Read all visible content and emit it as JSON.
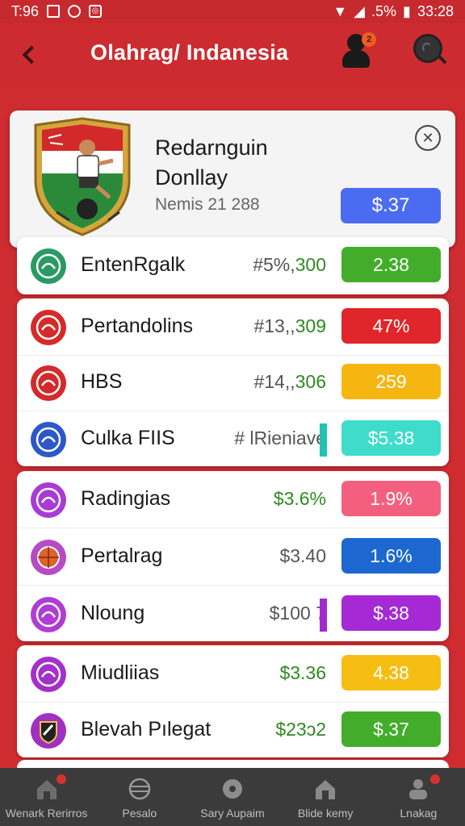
{
  "status_bar": {
    "time": "T:96",
    "battery": ".5%",
    "clock": "33:28"
  },
  "app_bar": {
    "title": "Olahrag/ Indanesia",
    "notification_count": "2"
  },
  "featured": {
    "title": "Redarnguin Donllay",
    "meta": "Nemis 21 288",
    "price": "$.37",
    "price_color": "#4b6cf0"
  },
  "groups": [
    {
      "items": [
        {
          "name": "EntenRgalk",
          "stat_prefix": "#5%,",
          "stat_value": "300",
          "value": "2.38",
          "color": "#43ad2b",
          "icon_color": "#2a9a63",
          "icon": "team-crest-icon"
        }
      ]
    },
    {
      "items": [
        {
          "name": "Pertandolins",
          "stat_prefix": "#13,,",
          "stat_value": "309",
          "value": "47%",
          "color": "#e0262a",
          "icon_color": "#d62a2a",
          "icon": "team-crest-icon"
        },
        {
          "name": "HBS",
          "stat_prefix": "#14,,",
          "stat_value": "306",
          "value": "259",
          "color": "#f6b611",
          "icon_color": "#d42a2a",
          "icon": "team-crest-icon"
        },
        {
          "name": "Culka FIIS",
          "stat_prefix": "# lRieniave",
          "stat_value": "",
          "value": "$5.38",
          "color": "#3fdccb",
          "icon_color": "#2d58c8",
          "icon": "team-crest-icon",
          "bar_color": "#22c3b0"
        }
      ]
    },
    {
      "items": [
        {
          "name": "Radingias",
          "stat_prefix": "",
          "stat_value": "$3.6%",
          "value": "1.9%",
          "color": "#f3607f",
          "icon_color": "#a93ad6",
          "icon": "team-crest-icon"
        },
        {
          "name": "Pertalrag",
          "stat_prefix": "$3.40",
          "stat_value": "",
          "value": "1.6%",
          "color": "#1c68d0",
          "icon_color": "#b64bc4",
          "icon": "basketball-icon"
        },
        {
          "name": "Nloung",
          "stat_prefix": "$100 7",
          "stat_value": "",
          "value": "$.38",
          "color": "#a52ad6",
          "icon_color": "#b03dd2",
          "icon": "team-crest-icon",
          "bar_color": "#a22bd0"
        }
      ]
    },
    {
      "items": [
        {
          "name": "Miudliias",
          "stat_prefix": "",
          "stat_value": "$3.36",
          "value": "4.38",
          "color": "#f6be12",
          "icon_color": "#a331c9",
          "icon": "team-crest-icon"
        },
        {
          "name": "Blevah Pılegat",
          "stat_prefix": "",
          "stat_value": "$23ɔ2",
          "value": "$.37",
          "color": "#43ad2b",
          "icon_color": "#a030c0",
          "icon": "shield-icon"
        }
      ]
    }
  ],
  "bottom_nav": [
    {
      "label": "Wenark Rerirros",
      "icon": "home-icon"
    },
    {
      "label": "Pesalo",
      "icon": "ball-icon"
    },
    {
      "label": "Sary Aupaim",
      "icon": "soccer-ball-icon"
    },
    {
      "label": "Blide kemy",
      "icon": "house-icon"
    },
    {
      "label": "Lnakag",
      "icon": "profile-icon"
    }
  ]
}
